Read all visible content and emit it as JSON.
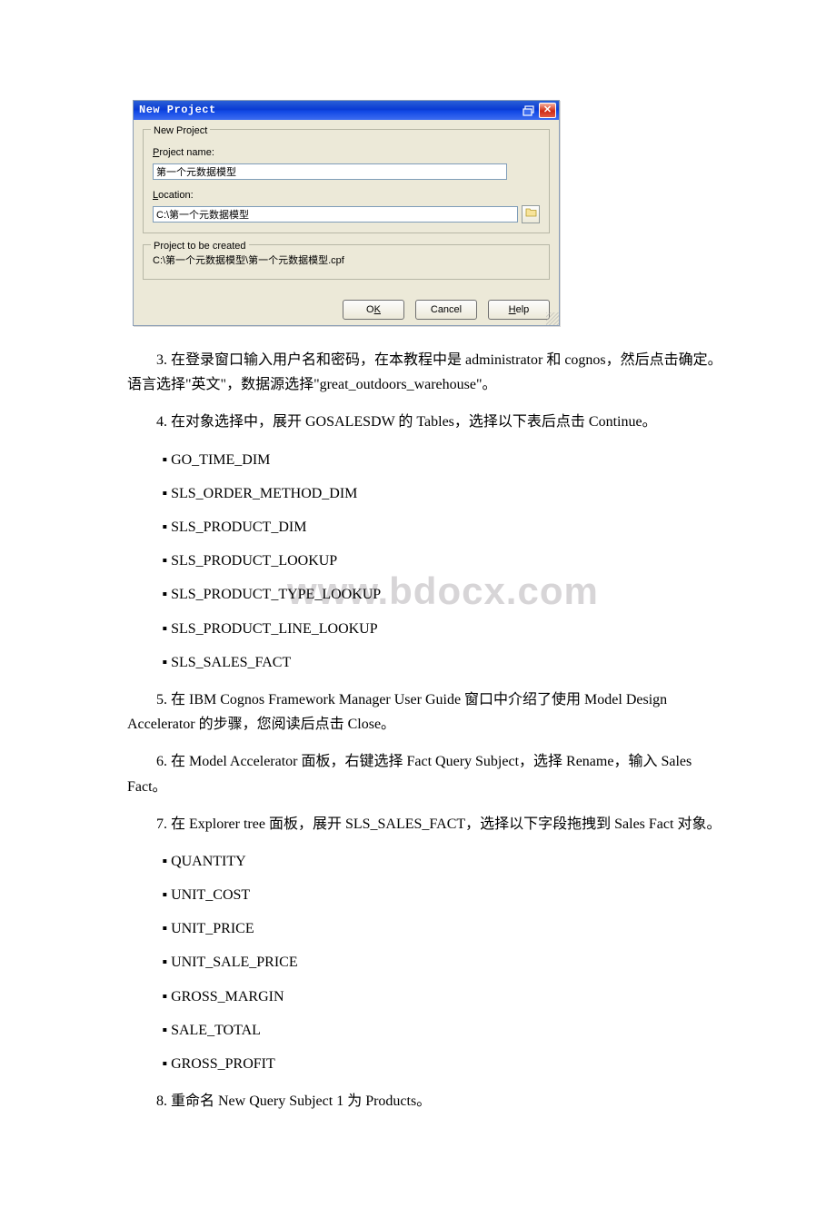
{
  "dialog": {
    "title": "New Project",
    "group1_legend": "New Project",
    "name_label": "Project name:",
    "name_value": "第一个元数据模型",
    "location_label": "Location:",
    "location_value": "C:\\第一个元数据模型",
    "group2_legend": "Project to be created",
    "path_text": "C:\\第一个元数据模型\\第一个元数据模型.cpf",
    "ok": "OK",
    "cancel": "Cancel",
    "help": "Help"
  },
  "body": {
    "p3": "3. 在登录窗口输入用户名和密码，在本教程中是 administrator 和 cognos，然后点击确定。语言选择\"英文\"，数据源选择\"great_outdoors_warehouse\"。",
    "p4": "4. 在对象选择中，展开 GOSALESDW 的 Tables，选择以下表后点击 Continue。",
    "tables": {
      "t1": "GO_TIME_DIM",
      "t2": "SLS_ORDER_METHOD_DIM",
      "t3": "SLS_PRODUCT_DIM",
      "t4": "SLS_PRODUCT_LOOKUP",
      "t5": "SLS_PRODUCT_TYPE_LOOKUP",
      "t6": "SLS_PRODUCT_LINE_LOOKUP",
      "t7": "SLS_SALES_FACT"
    },
    "p5": "5. 在 IBM Cognos Framework Manager User Guide 窗口中介绍了使用 Model Design Accelerator 的步骤，您阅读后点击 Close。",
    "p6": "6. 在 Model Accelerator 面板，右键选择 Fact Query Subject，选择 Rename，输入 Sales Fact。",
    "p7": "7. 在 Explorer tree 面板，展开 SLS_SALES_FACT，选择以下字段拖拽到 Sales Fact 对象。",
    "fields": {
      "f1": "QUANTITY",
      "f2": "UNIT_COST",
      "f3": "UNIT_PRICE",
      "f4": "UNIT_SALE_PRICE",
      "f5": "GROSS_MARGIN",
      "f6": "SALE_TOTAL",
      "f7": "GROSS_PROFIT"
    },
    "p8": "8. 重命名 New Query Subject 1 为 Products。"
  },
  "watermark": "www.bdocx.com"
}
